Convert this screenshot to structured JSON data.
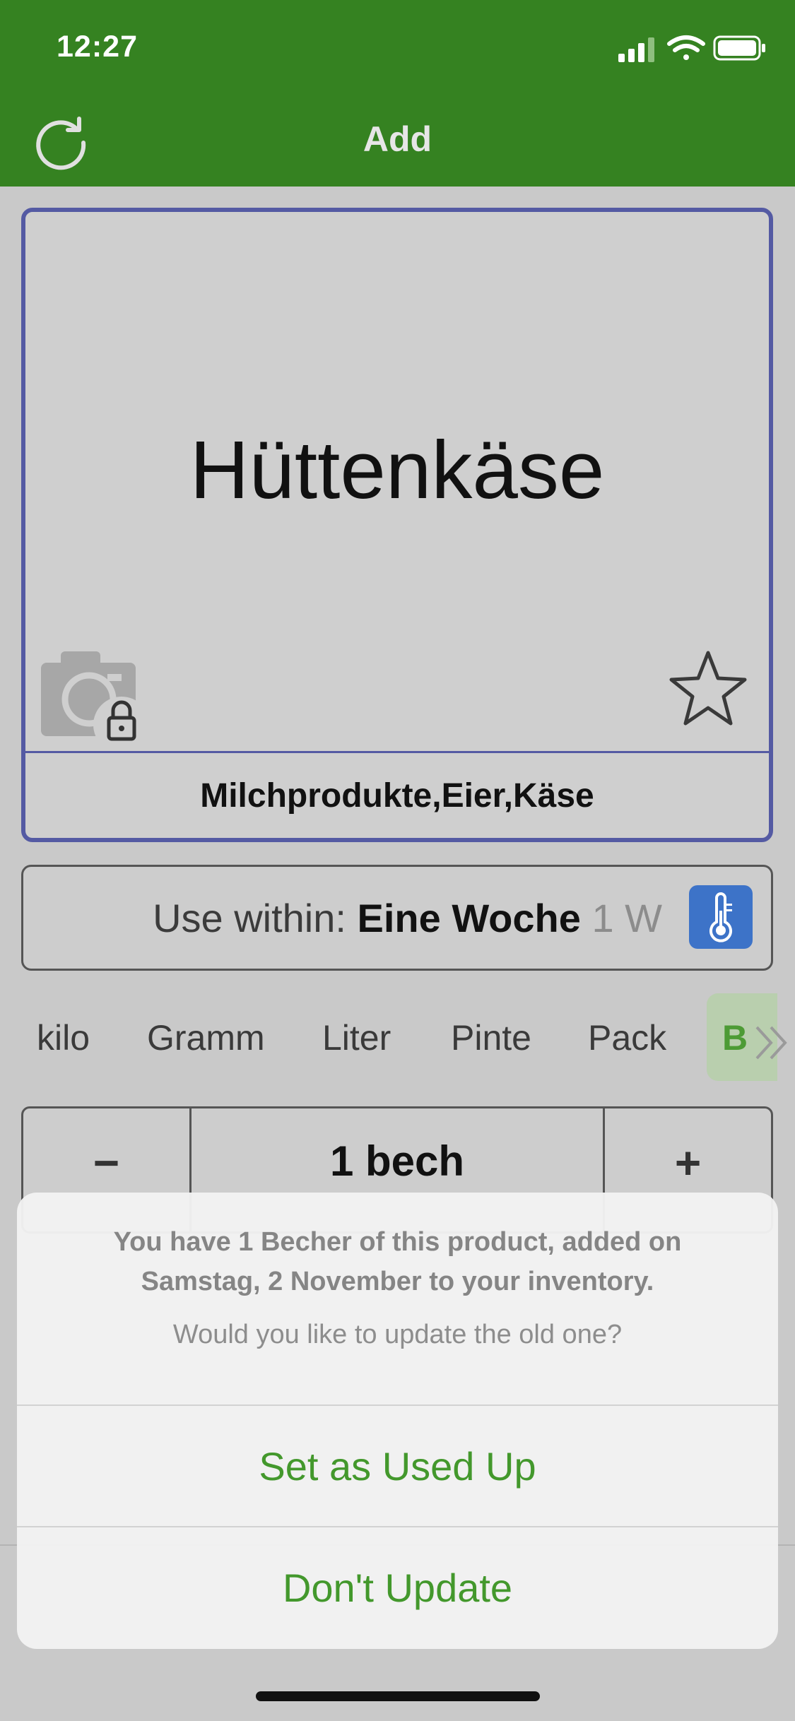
{
  "status_bar": {
    "time": "12:27"
  },
  "nav": {
    "title": "Add"
  },
  "product": {
    "name": "Hüttenkäse",
    "category": "Milchprodukte,Eier,Käse"
  },
  "use_within": {
    "label": "Use within:",
    "value": "Eine Woche",
    "short": "1 W"
  },
  "units": [
    "kilo",
    "Gramm",
    "Liter",
    "Pinte",
    "Pack",
    "B"
  ],
  "quantity": {
    "minus": "−",
    "value": "1 bech",
    "plus": "+"
  },
  "sheet": {
    "message": "You have 1 Becher of this product, added on Samstag, 2 November to your inventory.",
    "question": "Would you like to update the old one?",
    "primary": "Set as Used Up",
    "secondary": "Don't Update"
  },
  "colors": {
    "header": "#358221",
    "card_border": "#545aa3",
    "action_text": "#43982c",
    "thermometer_button": "#3d73c8"
  }
}
